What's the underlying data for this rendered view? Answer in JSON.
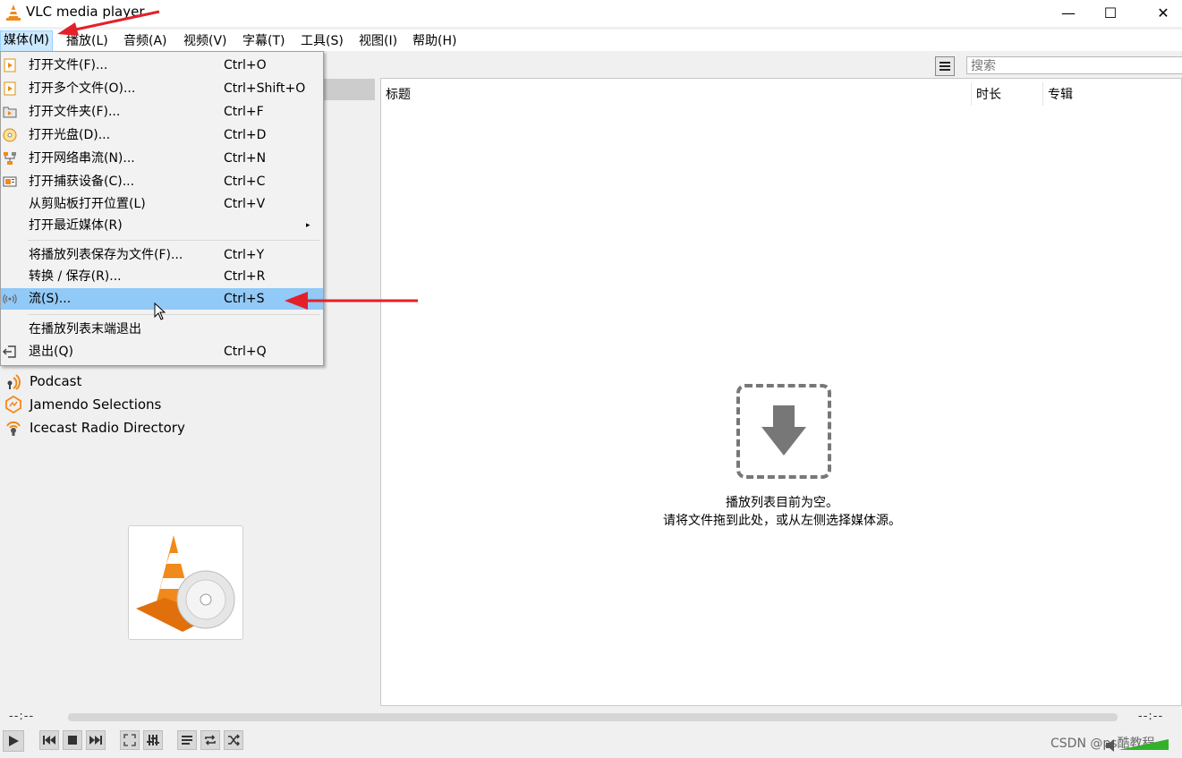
{
  "window": {
    "title": "VLC media player",
    "minimize_glyph": "—",
    "maximize_glyph": "☐",
    "close_glyph": "✕"
  },
  "menubar": {
    "items": [
      {
        "label": "媒体(M)",
        "active": true
      },
      {
        "label": "播放(L)"
      },
      {
        "label": "音频(A)"
      },
      {
        "label": "视频(V)"
      },
      {
        "label": "字幕(T)"
      },
      {
        "label": "工具(S)"
      },
      {
        "label": "视图(I)"
      },
      {
        "label": "帮助(H)"
      }
    ]
  },
  "media_menu": {
    "items": [
      {
        "label": "打开文件(F)...",
        "shortcut": "Ctrl+O",
        "icon": "open-file-icon"
      },
      {
        "label": "打开多个文件(O)...",
        "shortcut": "Ctrl+Shift+O",
        "icon": "open-multiple-files-icon"
      },
      {
        "label": "打开文件夹(F)...",
        "shortcut": "Ctrl+F",
        "icon": "open-folder-icon"
      },
      {
        "label": "打开光盘(D)...",
        "shortcut": "Ctrl+D",
        "icon": "disc-icon"
      },
      {
        "label": "打开网络串流(N)...",
        "shortcut": "Ctrl+N",
        "icon": "network-icon"
      },
      {
        "label": "打开捕获设备(C)...",
        "shortcut": "Ctrl+C",
        "icon": "capture-device-icon"
      },
      {
        "label": "从剪贴板打开位置(L)",
        "shortcut": "Ctrl+V"
      },
      {
        "label": "打开最近媒体(R)",
        "submenu": "▸"
      },
      {
        "label": "将播放列表保存为文件(F)...",
        "shortcut": "Ctrl+Y"
      },
      {
        "label": "转换 / 保存(R)...",
        "shortcut": "Ctrl+R"
      },
      {
        "label": "流(S)...",
        "shortcut": "Ctrl+S",
        "icon": "stream-icon",
        "highlighted": true
      },
      {
        "label": "在播放列表末端退出"
      },
      {
        "label": "退出(Q)",
        "shortcut": "Ctrl+Q",
        "icon": "quit-icon"
      }
    ]
  },
  "sidebar": {
    "items": [
      {
        "label": "Podcast",
        "icon": "podcast-icon"
      },
      {
        "label": "Jamendo Selections",
        "icon": "jamendo-icon"
      },
      {
        "label": "Icecast Radio Directory",
        "icon": "icecast-icon"
      }
    ]
  },
  "playlist": {
    "columns": [
      "标题",
      "时长",
      "专辑"
    ],
    "search_placeholder": "搜索",
    "empty_line1": "播放列表目前为空。",
    "empty_line2": "请将文件拖到此处，或从左侧选择媒体源。"
  },
  "transport": {
    "time_elapsed": "--:--",
    "time_total": "--:--"
  },
  "watermark": "CSDN @ps酷教程",
  "colors": {
    "highlight": "#91c9f7",
    "menu_active": "#cce8ff",
    "annotation_arrow": "#e3202a",
    "vlc_orange": "#f08a1c"
  }
}
